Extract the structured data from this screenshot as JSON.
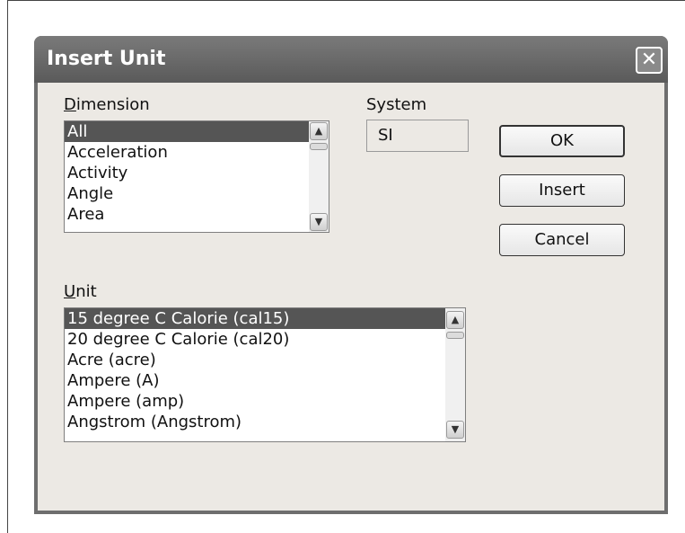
{
  "dialog": {
    "title": "Insert Unit",
    "close_symbol": "✕"
  },
  "dimension": {
    "label_accel": "D",
    "label_rest": "imension",
    "items": [
      "All",
      "Acceleration",
      "Activity",
      "Angle",
      "Area"
    ],
    "selected_index": 0
  },
  "system": {
    "label": "System",
    "value": "SI"
  },
  "unit": {
    "label_accel": "U",
    "label_rest": "nit",
    "items": [
      "15 degree C Calorie (cal15)",
      "20 degree C Calorie (cal20)",
      "Acre (acre)",
      "Ampere (A)",
      "Ampere (amp)",
      "Angstrom (Angstrom)"
    ],
    "selected_index": 0
  },
  "buttons": {
    "ok": "OK",
    "insert": "Insert",
    "cancel": "Cancel"
  },
  "icons": {
    "scroll_up": "▲",
    "scroll_down": "▼"
  }
}
